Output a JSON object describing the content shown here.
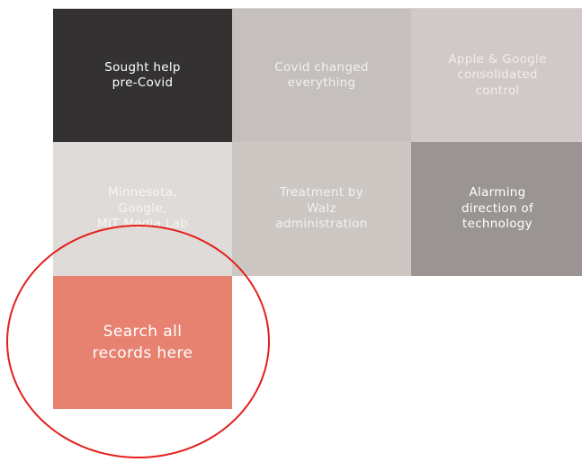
{
  "tiles": [
    {
      "label": "Sought help\npre-Covid"
    },
    {
      "label": "Covid changed\neverything"
    },
    {
      "label": "Apple & Google\nconsolidated\ncontrol"
    },
    {
      "label": "Minnesota,\nGoogle,\nMIT Media Lab"
    },
    {
      "label": "Treatment by\nWalz\nadministration"
    },
    {
      "label": "Alarming\ndirection of\ntechnology"
    }
  ],
  "search": {
    "label": "Search all\nrecords here"
  },
  "annotation": {
    "shape": "ellipse",
    "color": "#e3201b",
    "target": "search-records-tile"
  },
  "colors": {
    "dark": "#343132",
    "mid": "#c5c0bd",
    "light": "#d1c9c7",
    "pale": "#dedbd8",
    "grey": "#9a9592",
    "accent": "#e78170"
  }
}
